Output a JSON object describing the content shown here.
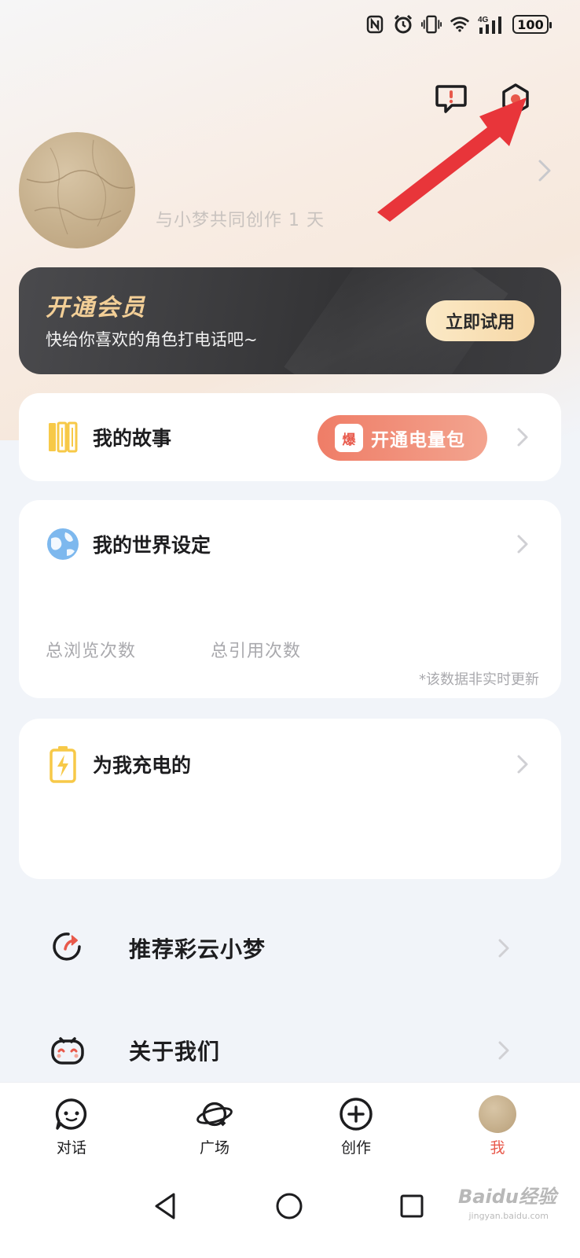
{
  "status_bar": {
    "battery": "100",
    "icons": [
      "nfc-icon",
      "alarm-icon",
      "vibrate-icon",
      "wifi-icon",
      "4g-signal-icon",
      "battery-icon"
    ],
    "network_label": "4G"
  },
  "header": {
    "icons": [
      "feedback-icon",
      "settings-icon"
    ]
  },
  "profile": {
    "cocreate_text": "与小梦共同创作 1 天"
  },
  "vip_banner": {
    "title": "开通会员",
    "subtitle": "快给你喜欢的角色打电话吧~",
    "button_label": "立即试用",
    "accent": "#f3cf97"
  },
  "cards": {
    "story": {
      "title": "我的故事",
      "boost_tag": "爆",
      "boost_label": "开通电量包",
      "icon": "books-icon"
    },
    "world": {
      "title": "我的世界设定",
      "icon": "globe-icon",
      "stat_views": "总浏览次数",
      "stat_refs": "总引用次数",
      "note": "*该数据非实时更新"
    },
    "charge": {
      "title": "为我充电的",
      "icon": "battery-charge-icon"
    }
  },
  "list": [
    {
      "label": "推荐彩云小梦",
      "icon": "share-icon"
    },
    {
      "label": "关于我们",
      "icon": "robot-face-icon"
    }
  ],
  "bottom_nav": [
    {
      "label": "对话",
      "icon": "chat-bubble-icon",
      "active": false
    },
    {
      "label": "广场",
      "icon": "planet-icon",
      "active": false
    },
    {
      "label": "创作",
      "icon": "plus-circle-icon",
      "active": false
    },
    {
      "label": "我",
      "icon": "avatar",
      "active": true
    }
  ],
  "system_nav": [
    "back-icon",
    "home-icon",
    "recents-icon"
  ],
  "watermark": {
    "main": "Baidu经验",
    "sub": "jingyan.baidu.com"
  },
  "colors": {
    "primary_red": "#e8594b",
    "annotation_arrow": "#e8353a"
  }
}
